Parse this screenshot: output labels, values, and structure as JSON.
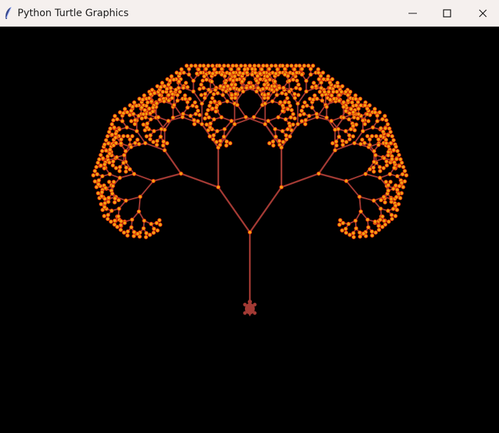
{
  "window": {
    "title": "Python Turtle Graphics",
    "controls": [
      "minimize",
      "maximize",
      "close"
    ]
  },
  "canvas": {
    "background": "#000000",
    "branch_color": "#a33a34",
    "leaf_color": "#f3a111",
    "leaf_outline": "#d92a08",
    "turtle_color": "#a33a34"
  },
  "icons": {
    "app": "feather-icon",
    "minimize": "minimize-icon",
    "maximize": "maximize-icon",
    "close": "close-icon"
  }
}
